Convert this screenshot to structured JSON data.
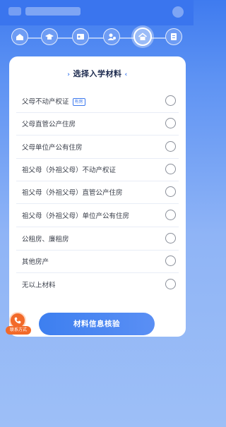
{
  "header": {
    "title": "",
    "blurred": true
  },
  "steps": [
    {
      "icon": "home-icon",
      "active": false
    },
    {
      "icon": "graduation-cap-icon",
      "active": false
    },
    {
      "icon": "id-card-icon",
      "active": false
    },
    {
      "icon": "guardian-icon",
      "active": false
    },
    {
      "icon": "house-icon",
      "active": true
    },
    {
      "icon": "document-icon",
      "active": false
    }
  ],
  "card": {
    "title": "选择入学材料",
    "options": [
      {
        "label": "父母不动产权证",
        "tag": "有房"
      },
      {
        "label": "父母直管公产住房"
      },
      {
        "label": "父母单位产公有住房"
      },
      {
        "label": "祖父母（外祖父母）不动产权证"
      },
      {
        "label": "祖父母（外祖父母）直管公产住房"
      },
      {
        "label": "祖父母（外祖父母）单位产公有住房"
      },
      {
        "label": "公租房、廉租房"
      },
      {
        "label": "其他房产"
      },
      {
        "label": "无以上材料"
      }
    ]
  },
  "actions": {
    "verify_label": "材料信息核验"
  },
  "contact": {
    "label": "联系方式"
  },
  "colors": {
    "primary": "#3b78ee",
    "contact": "#f26a2a"
  }
}
